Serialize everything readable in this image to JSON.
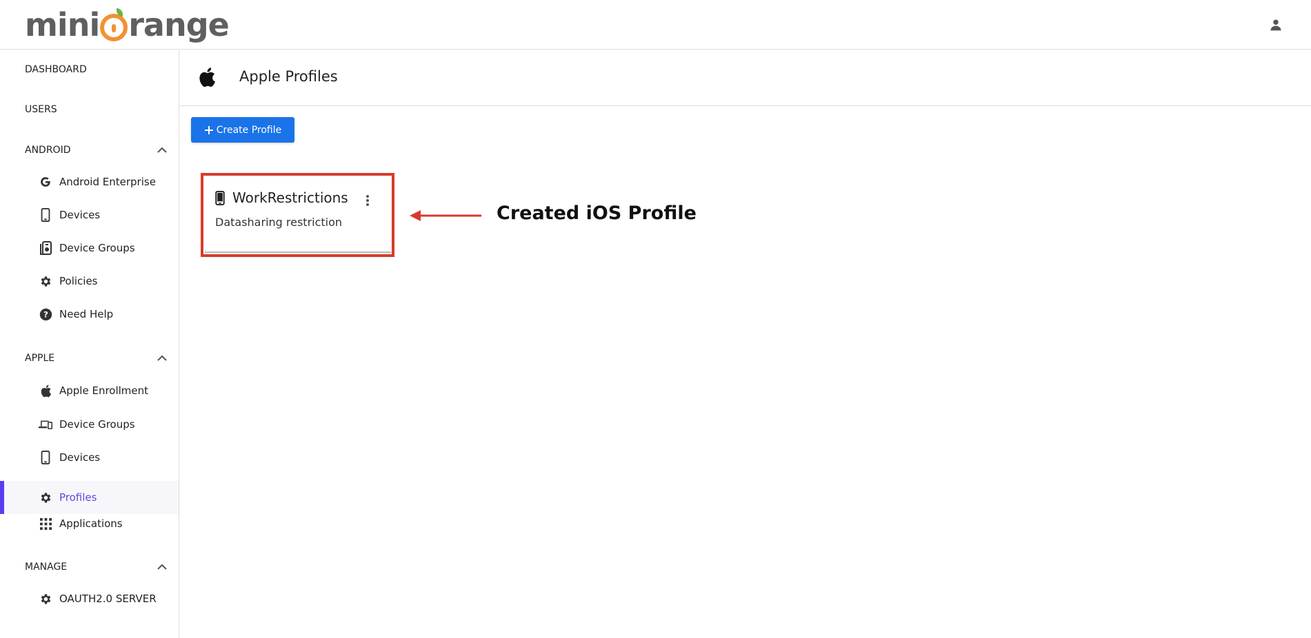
{
  "brand": {
    "logo_prefix": "mini",
    "logo_suffix": "range",
    "orange": "#f29133",
    "leaf": "#6cb43f"
  },
  "header": {
    "user_icon": "user-icon"
  },
  "sidebar": {
    "top": [
      {
        "label": "DASHBOARD"
      },
      {
        "label": "USERS"
      }
    ],
    "android": {
      "label": "ANDROID",
      "items": [
        {
          "label": "Android Enterprise",
          "icon": "google-icon"
        },
        {
          "label": "Devices",
          "icon": "phone-icon"
        },
        {
          "label": "Device Groups",
          "icon": "device-group-icon"
        },
        {
          "label": "Policies",
          "icon": "gear-icon"
        },
        {
          "label": "Need Help",
          "icon": "help-icon"
        }
      ]
    },
    "apple": {
      "label": "APPLE",
      "items": [
        {
          "label": "Apple Enrollment",
          "icon": "apple-icon"
        },
        {
          "label": "Device Groups",
          "icon": "devices-icon"
        },
        {
          "label": "Devices",
          "icon": "phone-icon"
        },
        {
          "label": "Profiles",
          "icon": "gear-icon",
          "active": true
        },
        {
          "label": "Applications",
          "icon": "grid-icon"
        }
      ]
    },
    "manage": {
      "label": "MANAGE",
      "items": [
        {
          "label": "OAUTH2.0 SERVER",
          "icon": "gear-icon"
        }
      ]
    },
    "active_color": "#5b3cf0"
  },
  "main": {
    "title": "Apple Profiles",
    "create_button": "Create Profile",
    "button_color": "#1a73e8",
    "card": {
      "title": "WorkRestrictions",
      "description": "Datasharing restriction"
    }
  },
  "annotation": {
    "text": "Created iOS Profile",
    "color": "#d93a2b"
  }
}
